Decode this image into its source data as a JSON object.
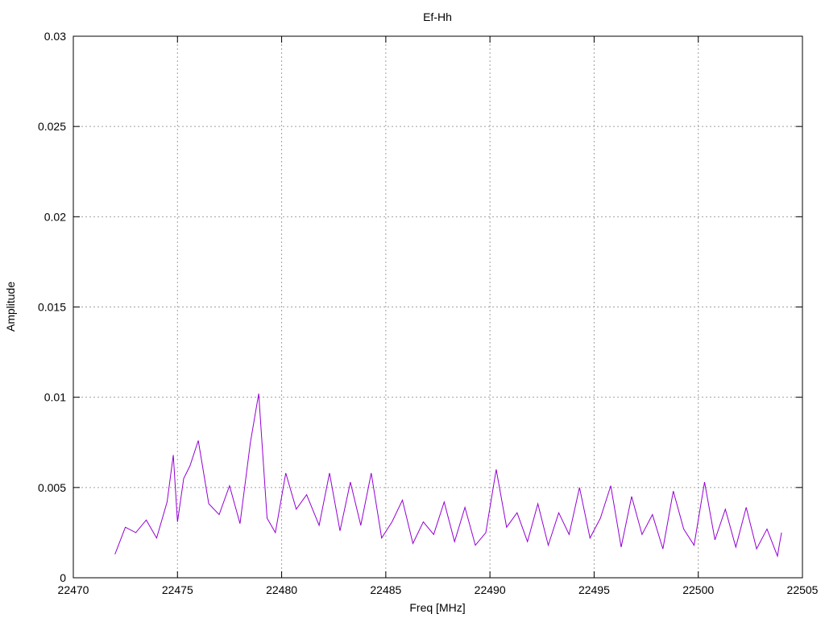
{
  "chart_data": {
    "type": "line",
    "title": "Ef-Hh",
    "xlabel": "Freq [MHz]",
    "ylabel": "Amplitude",
    "xlim": [
      22470,
      22505
    ],
    "ylim": [
      0,
      0.03
    ],
    "xticks": [
      22470,
      22475,
      22480,
      22485,
      22490,
      22495,
      22500,
      22505
    ],
    "yticks": [
      0,
      0.005,
      0.01,
      0.015,
      0.02,
      0.025,
      0.03
    ],
    "xtick_labels": [
      "22470",
      "22475",
      "22480",
      "22485",
      "22490",
      "22495",
      "22500",
      "22505"
    ],
    "ytick_labels": [
      "0",
      "0.005",
      "0.01",
      "0.015",
      "0.02",
      "0.025",
      "0.03"
    ],
    "grid": true,
    "line_color": "#9400d3",
    "series": [
      {
        "x": [
          22472.0,
          22472.5,
          22473.0,
          22473.5,
          22474.0,
          22474.5,
          22474.8,
          22475.0,
          22475.3,
          22475.6,
          22476.0,
          22476.5,
          22477.0,
          22477.5,
          22478.0,
          22478.5,
          22478.9,
          22479.3,
          22479.7,
          22480.2,
          22480.7,
          22481.2,
          22481.8,
          22482.3,
          22482.8,
          22483.3,
          22483.8,
          22484.3,
          22484.8,
          22485.3,
          22485.8,
          22486.3,
          22486.8,
          22487.3,
          22487.8,
          22488.3,
          22488.8,
          22489.3,
          22489.8,
          22490.3,
          22490.8,
          22491.3,
          22491.8,
          22492.3,
          22492.8,
          22493.3,
          22493.8,
          22494.3,
          22494.8,
          22495.3,
          22495.8,
          22496.3,
          22496.8,
          22497.3,
          22497.8,
          22498.3,
          22498.8,
          22499.3,
          22499.8,
          22500.3,
          22500.8,
          22501.3,
          22501.8,
          22502.3,
          22502.8,
          22503.3,
          22503.8,
          22503.9,
          22504.0
        ],
        "y": [
          0.0013,
          0.0028,
          0.0025,
          0.0032,
          0.0022,
          0.0042,
          0.0068,
          0.0031,
          0.0055,
          0.0062,
          0.0076,
          0.0041,
          0.0035,
          0.0051,
          0.003,
          0.0075,
          0.0102,
          0.0033,
          0.0025,
          0.0058,
          0.0038,
          0.0046,
          0.0029,
          0.0058,
          0.0026,
          0.0053,
          0.0029,
          0.0058,
          0.0022,
          0.0031,
          0.0043,
          0.0019,
          0.0031,
          0.0024,
          0.0042,
          0.002,
          0.0039,
          0.0018,
          0.0025,
          0.006,
          0.0028,
          0.0036,
          0.002,
          0.0041,
          0.0018,
          0.0036,
          0.0024,
          0.005,
          0.0022,
          0.0033,
          0.0051,
          0.0017,
          0.0045,
          0.0024,
          0.0035,
          0.0016,
          0.0048,
          0.0027,
          0.0018,
          0.0053,
          0.0021,
          0.0038,
          0.0017,
          0.0039,
          0.0016,
          0.0027,
          0.0012,
          0.0019,
          0.0025
        ]
      }
    ]
  }
}
